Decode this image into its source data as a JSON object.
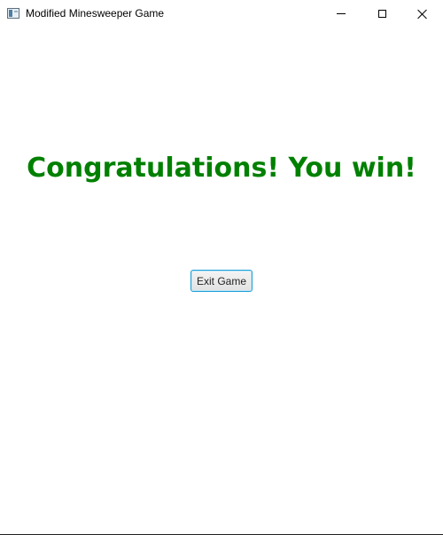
{
  "window": {
    "title": "Modified Minesweeper Game",
    "icon": "app-window-icon",
    "controls": [
      "minimize-icon",
      "maximize-icon",
      "close-icon"
    ]
  },
  "main": {
    "message": "Congratulations! You win!",
    "message_color": "#008000",
    "exit_label": "Exit Game"
  },
  "colors": {
    "button_focus_border": "#1e9fd6",
    "background": "#ffffff"
  }
}
